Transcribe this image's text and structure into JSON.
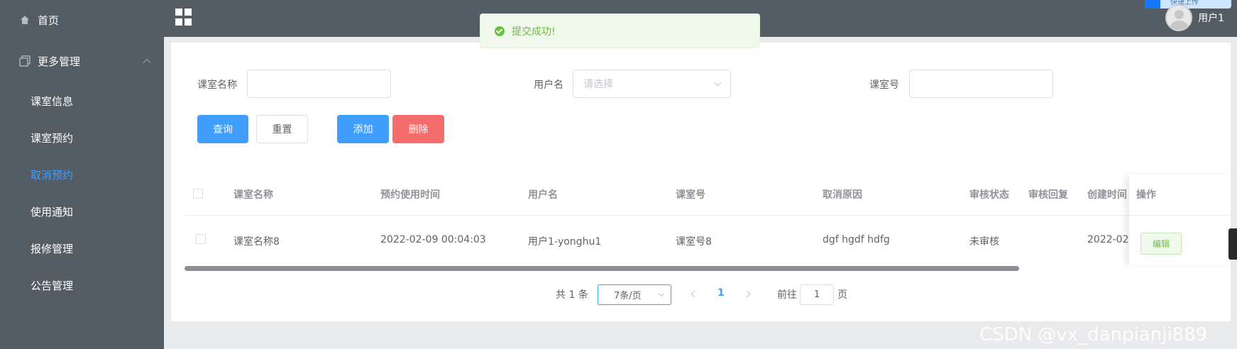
{
  "sidebar": {
    "items": [
      {
        "label": "首页",
        "icon": "home-icon"
      },
      {
        "label": "更多管理",
        "icon": "menu-icon"
      }
    ],
    "subitems": [
      {
        "label": "课室信息"
      },
      {
        "label": "课室预约"
      },
      {
        "label": "取消预约",
        "active": true
      },
      {
        "label": "使用通知"
      },
      {
        "label": "报修管理"
      },
      {
        "label": "公告管理"
      }
    ]
  },
  "header": {
    "menu_icon": "grid-icon",
    "username": "用户1",
    "upload_badge": "快捷上传"
  },
  "toast": {
    "message": "提交成功!",
    "type": "success"
  },
  "search": {
    "room_name_label": "课室名称",
    "room_name_value": "",
    "username_label": "用户名",
    "username_placeholder": "请选择",
    "room_no_label": "课室号",
    "room_no_value": ""
  },
  "buttons": {
    "query": "查询",
    "reset": "重置",
    "add": "添加",
    "delete": "删除"
  },
  "table": {
    "headers": [
      "课室名称",
      "预约使用时间",
      "用户名",
      "课室号",
      "取消原因",
      "审核状态",
      "审核回复",
      "创建时间",
      "操作"
    ],
    "rows": [
      {
        "room_name": "课室名称8",
        "time": "2022-02-09 00:04:03",
        "user": "用户1-yonghu1",
        "room_no": "课室号8",
        "reason": "dgf hgdf hdfg",
        "status": "未审核",
        "reply": "",
        "created": "2022-02-",
        "action": "编辑"
      }
    ]
  },
  "pagination": {
    "total": "共 1 条",
    "page_size": "7条/页",
    "current_page": "1",
    "goto_label": "前往",
    "goto_value": "1",
    "page_suffix": "页"
  },
  "watermark": "CSDN @vx_danpianji889",
  "colors": {
    "sidebar_bg": "#545c64",
    "primary": "#409eff",
    "danger": "#f56c6c",
    "success": "#67c23a"
  }
}
